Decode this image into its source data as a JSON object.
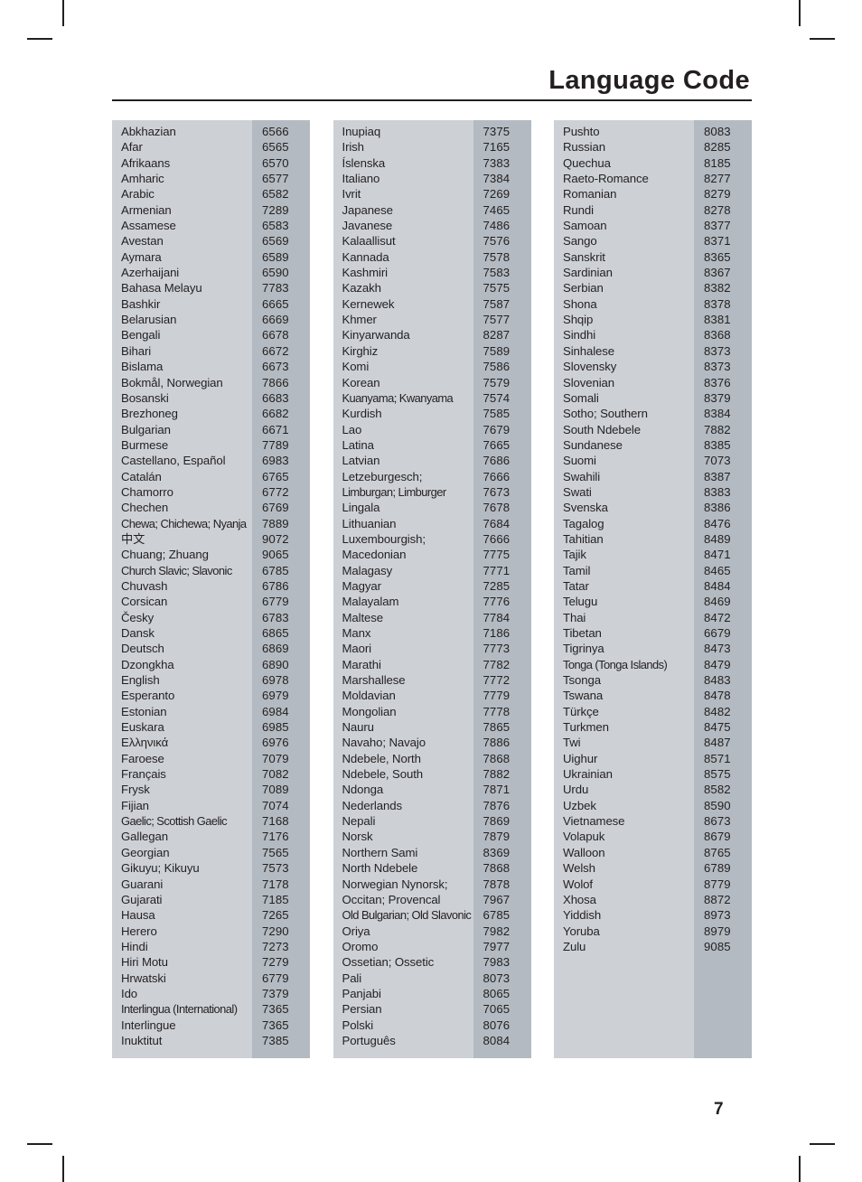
{
  "header": {
    "title": "Language Code"
  },
  "footer": {
    "page_number": "7"
  },
  "colors": {
    "name_cell_background": "#cdd1d6",
    "code_cell_background": "#b3bac1",
    "text": "#231f20",
    "rule": "#231f20"
  },
  "table": {
    "columns": [
      {
        "id": "column-1",
        "rows": [
          {
            "language": "Abkhazian",
            "code": "6566"
          },
          {
            "language": "Afar",
            "code": "6565"
          },
          {
            "language": "Afrikaans",
            "code": "6570"
          },
          {
            "language": "Amharic",
            "code": "6577"
          },
          {
            "language": "Arabic",
            "code": "6582"
          },
          {
            "language": "Armenian",
            "code": "7289"
          },
          {
            "language": "Assamese",
            "code": "6583"
          },
          {
            "language": "Avestan",
            "code": "6569"
          },
          {
            "language": "Aymara",
            "code": "6589"
          },
          {
            "language": "Azerhaijani",
            "code": "6590"
          },
          {
            "language": "Bahasa Melayu",
            "code": "7783"
          },
          {
            "language": "Bashkir",
            "code": "6665"
          },
          {
            "language": "Belarusian",
            "code": "6669"
          },
          {
            "language": "Bengali",
            "code": "6678"
          },
          {
            "language": "Bihari",
            "code": "6672"
          },
          {
            "language": "Bislama",
            "code": "6673"
          },
          {
            "language": "Bokmål, Norwegian",
            "code": "7866"
          },
          {
            "language": "Bosanski",
            "code": "6683"
          },
          {
            "language": "Brezhoneg",
            "code": "6682"
          },
          {
            "language": "Bulgarian",
            "code": "6671"
          },
          {
            "language": "Burmese",
            "code": "7789"
          },
          {
            "language": "Castellano, Español",
            "code": "6983"
          },
          {
            "language": "Catalán",
            "code": "6765"
          },
          {
            "language": "Chamorro",
            "code": "6772"
          },
          {
            "language": "Chechen",
            "code": "6769"
          },
          {
            "language": "Chewa; Chichewa; Nyanja",
            "code": "7889",
            "squeeze": true
          },
          {
            "language": "中文",
            "code": "9072"
          },
          {
            "language": "Chuang; Zhuang",
            "code": "9065"
          },
          {
            "language": "Church Slavic; Slavonic",
            "code": "6785",
            "squeeze": true
          },
          {
            "language": "Chuvash",
            "code": "6786"
          },
          {
            "language": "Corsican",
            "code": "6779"
          },
          {
            "language": "Česky",
            "code": "6783"
          },
          {
            "language": "Dansk",
            "code": "6865"
          },
          {
            "language": "Deutsch",
            "code": "6869"
          },
          {
            "language": "Dzongkha",
            "code": "6890"
          },
          {
            "language": "English",
            "code": "6978"
          },
          {
            "language": "Esperanto",
            "code": "6979"
          },
          {
            "language": "Estonian",
            "code": "6984"
          },
          {
            "language": "Euskara",
            "code": "6985"
          },
          {
            "language": "Ελληνικά",
            "code": "6976"
          },
          {
            "language": "Faroese",
            "code": "7079"
          },
          {
            "language": "Français",
            "code": "7082"
          },
          {
            "language": "Frysk",
            "code": "7089"
          },
          {
            "language": "Fijian",
            "code": "7074"
          },
          {
            "language": "Gaelic; Scottish Gaelic",
            "code": "7168",
            "squeeze": true
          },
          {
            "language": "Gallegan",
            "code": "7176"
          },
          {
            "language": "Georgian",
            "code": "7565"
          },
          {
            "language": "Gikuyu; Kikuyu",
            "code": "7573"
          },
          {
            "language": "Guarani",
            "code": "7178"
          },
          {
            "language": "Gujarati",
            "code": "7185"
          },
          {
            "language": "Hausa",
            "code": "7265"
          },
          {
            "language": "Herero",
            "code": "7290"
          },
          {
            "language": "Hindi",
            "code": "7273"
          },
          {
            "language": "Hiri Motu",
            "code": "7279"
          },
          {
            "language": "Hrwatski",
            "code": "6779"
          },
          {
            "language": "Ido",
            "code": "7379"
          },
          {
            "language": "Interlingua (International)",
            "code": "7365",
            "squeeze": true
          },
          {
            "language": "Interlingue",
            "code": "7365"
          },
          {
            "language": "Inuktitut",
            "code": "7385"
          }
        ]
      },
      {
        "id": "column-2",
        "rows": [
          {
            "language": "Inupiaq",
            "code": "7375"
          },
          {
            "language": "Irish",
            "code": "7165"
          },
          {
            "language": "Íslenska",
            "code": "7383"
          },
          {
            "language": "Italiano",
            "code": "7384"
          },
          {
            "language": "Ivrit",
            "code": "7269"
          },
          {
            "language": "Japanese",
            "code": "7465"
          },
          {
            "language": "Javanese",
            "code": "7486"
          },
          {
            "language": "Kalaallisut",
            "code": "7576"
          },
          {
            "language": "Kannada",
            "code": "7578"
          },
          {
            "language": "Kashmiri",
            "code": "7583"
          },
          {
            "language": "Kazakh",
            "code": "7575"
          },
          {
            "language": "Kernewek",
            "code": "7587"
          },
          {
            "language": "Khmer",
            "code": "7577"
          },
          {
            "language": "Kinyarwanda",
            "code": "8287"
          },
          {
            "language": "Kirghiz",
            "code": "7589"
          },
          {
            "language": "Komi",
            "code": "7586"
          },
          {
            "language": "Korean",
            "code": "7579"
          },
          {
            "language": "Kuanyama; Kwanyama",
            "code": "7574",
            "squeeze": true
          },
          {
            "language": "Kurdish",
            "code": "7585"
          },
          {
            "language": "Lao",
            "code": "7679"
          },
          {
            "language": "Latina",
            "code": "7665"
          },
          {
            "language": "Latvian",
            "code": "7686"
          },
          {
            "language": "Letzeburgesch;",
            "code": "7666"
          },
          {
            "language": "Limburgan; Limburger",
            "code": "7673",
            "squeeze": true
          },
          {
            "language": "Lingala",
            "code": "7678"
          },
          {
            "language": "Lithuanian",
            "code": "7684"
          },
          {
            "language": "Luxembourgish;",
            "code": "7666"
          },
          {
            "language": "Macedonian",
            "code": "7775"
          },
          {
            "language": "Malagasy",
            "code": "7771"
          },
          {
            "language": "Magyar",
            "code": "7285"
          },
          {
            "language": "Malayalam",
            "code": "7776"
          },
          {
            "language": "Maltese",
            "code": "7784"
          },
          {
            "language": "Manx",
            "code": "7186"
          },
          {
            "language": "Maori",
            "code": "7773"
          },
          {
            "language": "Marathi",
            "code": "7782"
          },
          {
            "language": "Marshallese",
            "code": "7772"
          },
          {
            "language": "Moldavian",
            "code": "7779"
          },
          {
            "language": "Mongolian",
            "code": "7778"
          },
          {
            "language": "Nauru",
            "code": "7865"
          },
          {
            "language": "Navaho; Navajo",
            "code": "7886"
          },
          {
            "language": "Ndebele, North",
            "code": "7868"
          },
          {
            "language": "Ndebele, South",
            "code": "7882"
          },
          {
            "language": "Ndonga",
            "code": "7871"
          },
          {
            "language": "Nederlands",
            "code": "7876"
          },
          {
            "language": "Nepali",
            "code": "7869"
          },
          {
            "language": "Norsk",
            "code": "7879"
          },
          {
            "language": "Northern Sami",
            "code": "8369"
          },
          {
            "language": "North Ndebele",
            "code": "7868"
          },
          {
            "language": "Norwegian Nynorsk;",
            "code": "7878"
          },
          {
            "language": "Occitan; Provencal",
            "code": "7967"
          },
          {
            "language": "Old Bulgarian; Old Slavonic",
            "code": "6785",
            "squeeze": true
          },
          {
            "language": "Oriya",
            "code": "7982"
          },
          {
            "language": "Oromo",
            "code": "7977"
          },
          {
            "language": "Ossetian; Ossetic",
            "code": "7983"
          },
          {
            "language": "Pali",
            "code": "8073"
          },
          {
            "language": "Panjabi",
            "code": "8065"
          },
          {
            "language": "Persian",
            "code": "7065"
          },
          {
            "language": "Polski",
            "code": "8076"
          },
          {
            "language": "Português",
            "code": "8084"
          }
        ]
      },
      {
        "id": "column-3",
        "rows": [
          {
            "language": "Pushto",
            "code": "8083"
          },
          {
            "language": "Russian",
            "code": "8285"
          },
          {
            "language": "Quechua",
            "code": "8185"
          },
          {
            "language": "Raeto-Romance",
            "code": "8277"
          },
          {
            "language": "Romanian",
            "code": "8279"
          },
          {
            "language": "Rundi",
            "code": "8278"
          },
          {
            "language": "Samoan",
            "code": "8377"
          },
          {
            "language": "Sango",
            "code": "8371"
          },
          {
            "language": "Sanskrit",
            "code": "8365"
          },
          {
            "language": "Sardinian",
            "code": "8367"
          },
          {
            "language": "Serbian",
            "code": "8382"
          },
          {
            "language": "Shona",
            "code": "8378"
          },
          {
            "language": "Shqip",
            "code": "8381"
          },
          {
            "language": "Sindhi",
            "code": "8368"
          },
          {
            "language": "Sinhalese",
            "code": "8373"
          },
          {
            "language": "Slovensky",
            "code": "8373"
          },
          {
            "language": "Slovenian",
            "code": "8376"
          },
          {
            "language": "Somali",
            "code": "8379"
          },
          {
            "language": "Sotho; Southern",
            "code": "8384"
          },
          {
            "language": "South Ndebele",
            "code": "7882"
          },
          {
            "language": "Sundanese",
            "code": "8385"
          },
          {
            "language": "Suomi",
            "code": "7073"
          },
          {
            "language": "Swahili",
            "code": "8387"
          },
          {
            "language": "Swati",
            "code": "8383"
          },
          {
            "language": "Svenska",
            "code": "8386"
          },
          {
            "language": "Tagalog",
            "code": "8476"
          },
          {
            "language": "Tahitian",
            "code": "8489"
          },
          {
            "language": "Tajik",
            "code": "8471"
          },
          {
            "language": "Tamil",
            "code": "8465"
          },
          {
            "language": "Tatar",
            "code": "8484"
          },
          {
            "language": "Telugu",
            "code": "8469"
          },
          {
            "language": "Thai",
            "code": "8472"
          },
          {
            "language": "Tibetan",
            "code": "6679"
          },
          {
            "language": "Tigrinya",
            "code": "8473"
          },
          {
            "language": "Tonga (Tonga Islands)",
            "code": "8479",
            "squeeze": true
          },
          {
            "language": "Tsonga",
            "code": "8483"
          },
          {
            "language": "Tswana",
            "code": "8478"
          },
          {
            "language": "Türkçe",
            "code": "8482"
          },
          {
            "language": "Turkmen",
            "code": "8475"
          },
          {
            "language": "Twi",
            "code": "8487"
          },
          {
            "language": "Uighur",
            "code": "8571"
          },
          {
            "language": "Ukrainian",
            "code": "8575"
          },
          {
            "language": "Urdu",
            "code": "8582"
          },
          {
            "language": "Uzbek",
            "code": "8590"
          },
          {
            "language": "Vietnamese",
            "code": "8673"
          },
          {
            "language": "Volapuk",
            "code": "8679"
          },
          {
            "language": "Walloon",
            "code": "8765"
          },
          {
            "language": "Welsh",
            "code": "6789"
          },
          {
            "language": "Wolof",
            "code": "8779"
          },
          {
            "language": "Xhosa",
            "code": "8872"
          },
          {
            "language": "Yiddish",
            "code": "8973"
          },
          {
            "language": "Yoruba",
            "code": "8979"
          },
          {
            "language": "Zulu",
            "code": "9085"
          }
        ]
      }
    ]
  }
}
